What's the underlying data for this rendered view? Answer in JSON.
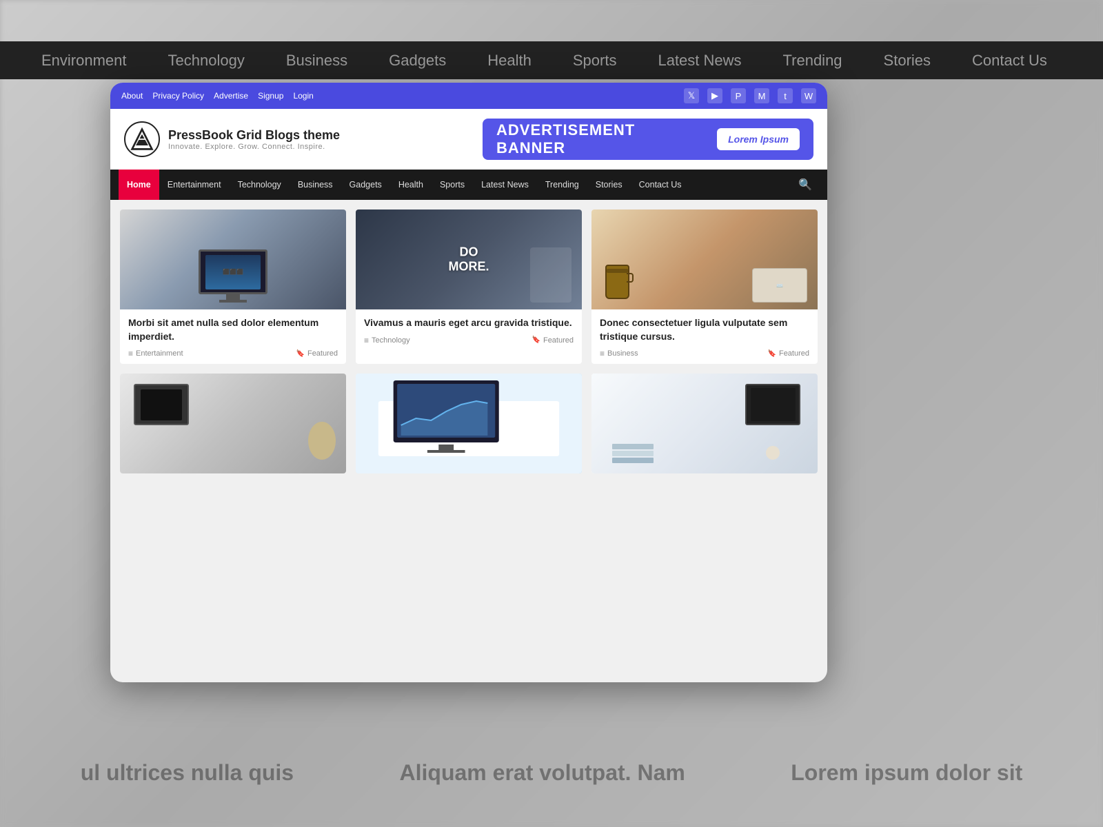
{
  "background": {
    "topbar_items": [
      "Environment",
      "Technology",
      "Business",
      "Gadgets",
      "Health",
      "Sports",
      "Latest News",
      "Trending",
      "Stories",
      "Contact Us"
    ]
  },
  "utility_bar": {
    "links": [
      "About",
      "Privacy Policy",
      "Advertise",
      "Signup",
      "Login"
    ],
    "social_icons": [
      "twitter",
      "youtube",
      "pinterest",
      "medium",
      "tumblr",
      "wordpress"
    ]
  },
  "site": {
    "name": "PressBook Grid Blogs theme",
    "tagline": "Innovate. Explore. Grow. Connect. Inspire."
  },
  "ad": {
    "text": "ADVERTISEMENT BANNER",
    "button": "Lorem Ipsum"
  },
  "nav": {
    "items": [
      "Home",
      "Entertainment",
      "Technology",
      "Business",
      "Gadgets",
      "Health",
      "Sports",
      "Latest News",
      "Trending",
      "Stories",
      "Contact Us"
    ]
  },
  "articles": [
    {
      "title": "Morbi sit amet nulla sed dolor elementum imperdiet.",
      "category": "Entertainment",
      "badge": "Featured",
      "img_type": "1"
    },
    {
      "title": "Vivamus a mauris eget arcu gravida tristique.",
      "category": "Technology",
      "badge": "Featured",
      "img_type": "2"
    },
    {
      "title": "Donec consectetuer ligula vulputate sem tristique cursus.",
      "category": "Business",
      "badge": "Featured",
      "img_type": "3"
    },
    {
      "title": "",
      "category": "",
      "badge": "",
      "img_type": "4"
    },
    {
      "title": "",
      "category": "",
      "badge": "",
      "img_type": "5"
    },
    {
      "title": "",
      "category": "",
      "badge": "",
      "img_type": "6"
    }
  ]
}
